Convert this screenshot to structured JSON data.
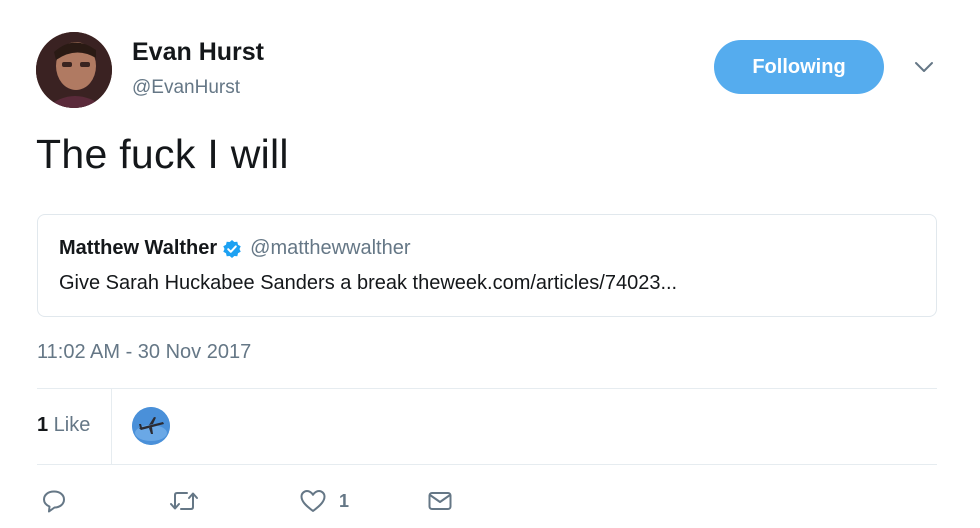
{
  "author": {
    "display_name": "Evan Hurst",
    "screen_name": "@EvanHurst",
    "avatar_icon": "user-avatar"
  },
  "follow_button": {
    "label": "Following",
    "color": "#55acee"
  },
  "menu_icon": "chevron-down-icon",
  "tweet": {
    "text": "The fuck I will"
  },
  "quoted_tweet": {
    "display_name": "Matthew Walther",
    "verified_icon": "verified-badge-icon",
    "screen_name": "@matthewwalther",
    "text": "Give Sarah Huckabee Sanders a break theweek.com/articles/74023..."
  },
  "timestamp": "11:02 AM - 30 Nov 2017",
  "stats": {
    "likes_number": "1",
    "likes_label": " Like",
    "liker_avatar_icon": "airplane-avatar"
  },
  "actions": {
    "reply_icon": "reply-icon",
    "retweet_icon": "retweet-icon",
    "like_icon": "heart-icon",
    "like_count": "1",
    "dm_icon": "envelope-icon"
  },
  "colors": {
    "accent": "#55acee",
    "secondary_text": "#657786",
    "verified": "#1da1f2"
  }
}
